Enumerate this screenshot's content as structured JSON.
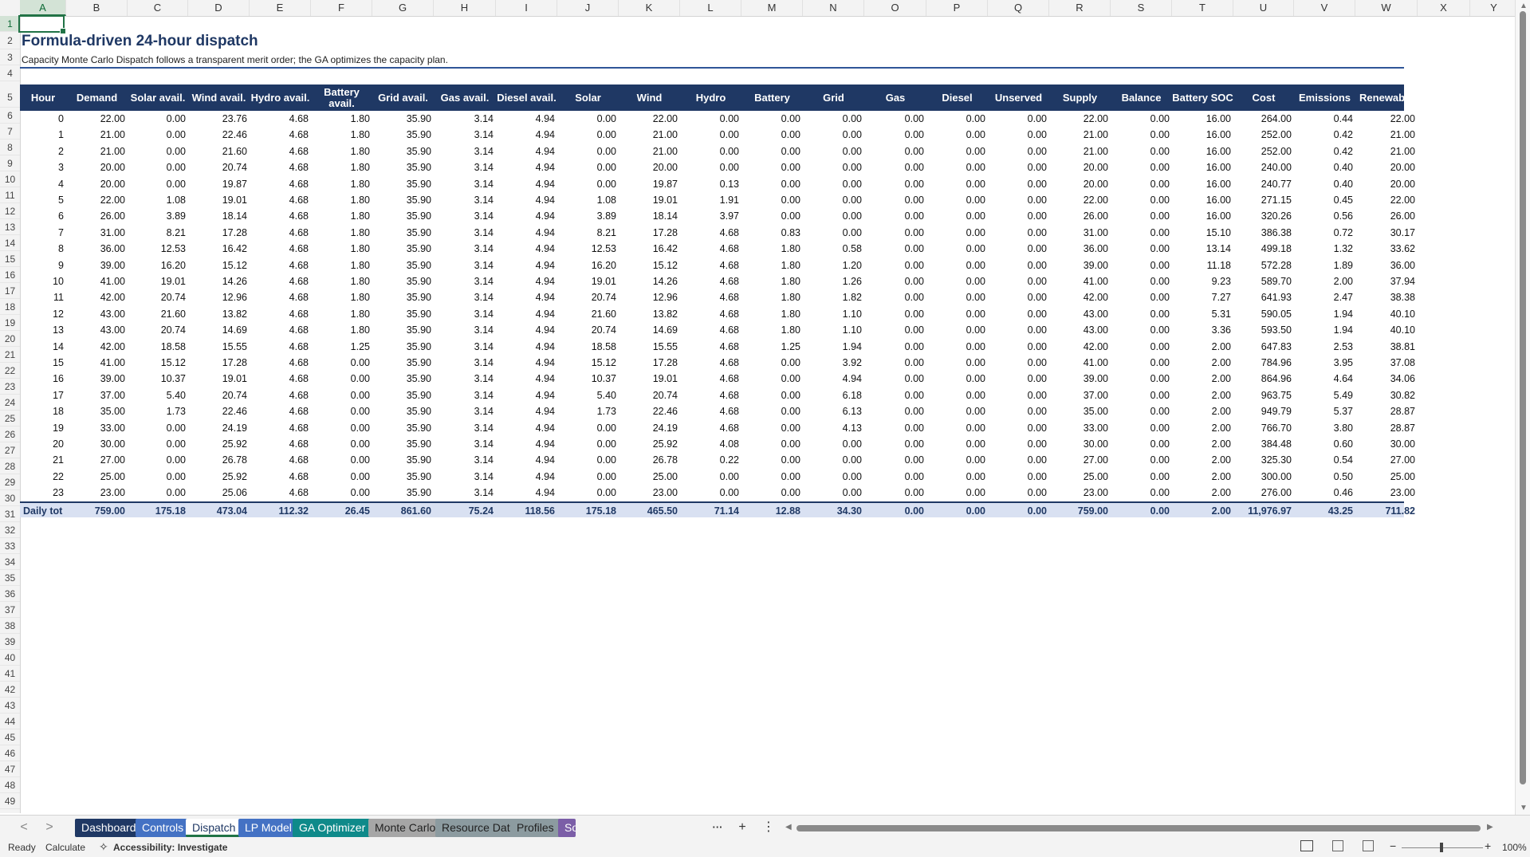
{
  "columns": [
    "A",
    "B",
    "C",
    "D",
    "E",
    "F",
    "G",
    "H",
    "I",
    "J",
    "K",
    "L",
    "M",
    "N",
    "O",
    "P",
    "Q",
    "R",
    "S",
    "T",
    "U",
    "V",
    "W",
    "X",
    "Y"
  ],
  "selected_column": "A",
  "rows": [
    "1",
    "2",
    "3",
    "4",
    "5",
    "6",
    "7",
    "8",
    "9",
    "10",
    "11",
    "12",
    "13",
    "14",
    "15",
    "16",
    "17",
    "18",
    "19",
    "20",
    "21",
    "22",
    "23",
    "24",
    "25",
    "26",
    "27",
    "28",
    "29",
    "30",
    "31",
    "32",
    "33",
    "34",
    "35",
    "36",
    "37",
    "38",
    "39",
    "40",
    "41",
    "42",
    "43",
    "44",
    "45",
    "46",
    "47",
    "48",
    "49"
  ],
  "selected_row": "1",
  "sheet": {
    "title": "Formula-driven 24-hour dispatch",
    "subtitle": "Capacity Monte Carlo  Dispatch follows a transparent merit order; the GA optimizes the capacity plan."
  },
  "table": {
    "headers": [
      "Hour",
      "Demand",
      "Solar avail.",
      "Wind avail.",
      "Hydro avail.",
      "Battery avail.",
      "Grid avail.",
      "Gas avail.",
      "Diesel avail.",
      "Solar",
      "Wind",
      "Hydro",
      "Battery",
      "Grid",
      "Gas",
      "Diesel",
      "Unserved",
      "Supply",
      "Balance",
      "Battery SOC",
      "Cost",
      "Emissions",
      "Renewable"
    ],
    "rows": [
      [
        "0",
        "22.00",
        "0.00",
        "23.76",
        "4.68",
        "1.80",
        "35.90",
        "3.14",
        "4.94",
        "0.00",
        "22.00",
        "0.00",
        "0.00",
        "0.00",
        "0.00",
        "0.00",
        "0.00",
        "22.00",
        "0.00",
        "16.00",
        "264.00",
        "0.44",
        "22.00"
      ],
      [
        "1",
        "21.00",
        "0.00",
        "22.46",
        "4.68",
        "1.80",
        "35.90",
        "3.14",
        "4.94",
        "0.00",
        "21.00",
        "0.00",
        "0.00",
        "0.00",
        "0.00",
        "0.00",
        "0.00",
        "21.00",
        "0.00",
        "16.00",
        "252.00",
        "0.42",
        "21.00"
      ],
      [
        "2",
        "21.00",
        "0.00",
        "21.60",
        "4.68",
        "1.80",
        "35.90",
        "3.14",
        "4.94",
        "0.00",
        "21.00",
        "0.00",
        "0.00",
        "0.00",
        "0.00",
        "0.00",
        "0.00",
        "21.00",
        "0.00",
        "16.00",
        "252.00",
        "0.42",
        "21.00"
      ],
      [
        "3",
        "20.00",
        "0.00",
        "20.74",
        "4.68",
        "1.80",
        "35.90",
        "3.14",
        "4.94",
        "0.00",
        "20.00",
        "0.00",
        "0.00",
        "0.00",
        "0.00",
        "0.00",
        "0.00",
        "20.00",
        "0.00",
        "16.00",
        "240.00",
        "0.40",
        "20.00"
      ],
      [
        "4",
        "20.00",
        "0.00",
        "19.87",
        "4.68",
        "1.80",
        "35.90",
        "3.14",
        "4.94",
        "0.00",
        "19.87",
        "0.13",
        "0.00",
        "0.00",
        "0.00",
        "0.00",
        "0.00",
        "20.00",
        "0.00",
        "16.00",
        "240.77",
        "0.40",
        "20.00"
      ],
      [
        "5",
        "22.00",
        "1.08",
        "19.01",
        "4.68",
        "1.80",
        "35.90",
        "3.14",
        "4.94",
        "1.08",
        "19.01",
        "1.91",
        "0.00",
        "0.00",
        "0.00",
        "0.00",
        "0.00",
        "22.00",
        "0.00",
        "16.00",
        "271.15",
        "0.45",
        "22.00"
      ],
      [
        "6",
        "26.00",
        "3.89",
        "18.14",
        "4.68",
        "1.80",
        "35.90",
        "3.14",
        "4.94",
        "3.89",
        "18.14",
        "3.97",
        "0.00",
        "0.00",
        "0.00",
        "0.00",
        "0.00",
        "26.00",
        "0.00",
        "16.00",
        "320.26",
        "0.56",
        "26.00"
      ],
      [
        "7",
        "31.00",
        "8.21",
        "17.28",
        "4.68",
        "1.80",
        "35.90",
        "3.14",
        "4.94",
        "8.21",
        "17.28",
        "4.68",
        "0.83",
        "0.00",
        "0.00",
        "0.00",
        "0.00",
        "31.00",
        "0.00",
        "15.10",
        "386.38",
        "0.72",
        "30.17"
      ],
      [
        "8",
        "36.00",
        "12.53",
        "16.42",
        "4.68",
        "1.80",
        "35.90",
        "3.14",
        "4.94",
        "12.53",
        "16.42",
        "4.68",
        "1.80",
        "0.58",
        "0.00",
        "0.00",
        "0.00",
        "36.00",
        "0.00",
        "13.14",
        "499.18",
        "1.32",
        "33.62"
      ],
      [
        "9",
        "39.00",
        "16.20",
        "15.12",
        "4.68",
        "1.80",
        "35.90",
        "3.14",
        "4.94",
        "16.20",
        "15.12",
        "4.68",
        "1.80",
        "1.20",
        "0.00",
        "0.00",
        "0.00",
        "39.00",
        "0.00",
        "11.18",
        "572.28",
        "1.89",
        "36.00"
      ],
      [
        "10",
        "41.00",
        "19.01",
        "14.26",
        "4.68",
        "1.80",
        "35.90",
        "3.14",
        "4.94",
        "19.01",
        "14.26",
        "4.68",
        "1.80",
        "1.26",
        "0.00",
        "0.00",
        "0.00",
        "41.00",
        "0.00",
        "9.23",
        "589.70",
        "2.00",
        "37.94"
      ],
      [
        "11",
        "42.00",
        "20.74",
        "12.96",
        "4.68",
        "1.80",
        "35.90",
        "3.14",
        "4.94",
        "20.74",
        "12.96",
        "4.68",
        "1.80",
        "1.82",
        "0.00",
        "0.00",
        "0.00",
        "42.00",
        "0.00",
        "7.27",
        "641.93",
        "2.47",
        "38.38"
      ],
      [
        "12",
        "43.00",
        "21.60",
        "13.82",
        "4.68",
        "1.80",
        "35.90",
        "3.14",
        "4.94",
        "21.60",
        "13.82",
        "4.68",
        "1.80",
        "1.10",
        "0.00",
        "0.00",
        "0.00",
        "43.00",
        "0.00",
        "5.31",
        "590.05",
        "1.94",
        "40.10"
      ],
      [
        "13",
        "43.00",
        "20.74",
        "14.69",
        "4.68",
        "1.80",
        "35.90",
        "3.14",
        "4.94",
        "20.74",
        "14.69",
        "4.68",
        "1.80",
        "1.10",
        "0.00",
        "0.00",
        "0.00",
        "43.00",
        "0.00",
        "3.36",
        "593.50",
        "1.94",
        "40.10"
      ],
      [
        "14",
        "42.00",
        "18.58",
        "15.55",
        "4.68",
        "1.25",
        "35.90",
        "3.14",
        "4.94",
        "18.58",
        "15.55",
        "4.68",
        "1.25",
        "1.94",
        "0.00",
        "0.00",
        "0.00",
        "42.00",
        "0.00",
        "2.00",
        "647.83",
        "2.53",
        "38.81"
      ],
      [
        "15",
        "41.00",
        "15.12",
        "17.28",
        "4.68",
        "0.00",
        "35.90",
        "3.14",
        "4.94",
        "15.12",
        "17.28",
        "4.68",
        "0.00",
        "3.92",
        "0.00",
        "0.00",
        "0.00",
        "41.00",
        "0.00",
        "2.00",
        "784.96",
        "3.95",
        "37.08"
      ],
      [
        "16",
        "39.00",
        "10.37",
        "19.01",
        "4.68",
        "0.00",
        "35.90",
        "3.14",
        "4.94",
        "10.37",
        "19.01",
        "4.68",
        "0.00",
        "4.94",
        "0.00",
        "0.00",
        "0.00",
        "39.00",
        "0.00",
        "2.00",
        "864.96",
        "4.64",
        "34.06"
      ],
      [
        "17",
        "37.00",
        "5.40",
        "20.74",
        "4.68",
        "0.00",
        "35.90",
        "3.14",
        "4.94",
        "5.40",
        "20.74",
        "4.68",
        "0.00",
        "6.18",
        "0.00",
        "0.00",
        "0.00",
        "37.00",
        "0.00",
        "2.00",
        "963.75",
        "5.49",
        "30.82"
      ],
      [
        "18",
        "35.00",
        "1.73",
        "22.46",
        "4.68",
        "0.00",
        "35.90",
        "3.14",
        "4.94",
        "1.73",
        "22.46",
        "4.68",
        "0.00",
        "6.13",
        "0.00",
        "0.00",
        "0.00",
        "35.00",
        "0.00",
        "2.00",
        "949.79",
        "5.37",
        "28.87"
      ],
      [
        "19",
        "33.00",
        "0.00",
        "24.19",
        "4.68",
        "0.00",
        "35.90",
        "3.14",
        "4.94",
        "0.00",
        "24.19",
        "4.68",
        "0.00",
        "4.13",
        "0.00",
        "0.00",
        "0.00",
        "33.00",
        "0.00",
        "2.00",
        "766.70",
        "3.80",
        "28.87"
      ],
      [
        "20",
        "30.00",
        "0.00",
        "25.92",
        "4.68",
        "0.00",
        "35.90",
        "3.14",
        "4.94",
        "0.00",
        "25.92",
        "4.08",
        "0.00",
        "0.00",
        "0.00",
        "0.00",
        "0.00",
        "30.00",
        "0.00",
        "2.00",
        "384.48",
        "0.60",
        "30.00"
      ],
      [
        "21",
        "27.00",
        "0.00",
        "26.78",
        "4.68",
        "0.00",
        "35.90",
        "3.14",
        "4.94",
        "0.00",
        "26.78",
        "0.22",
        "0.00",
        "0.00",
        "0.00",
        "0.00",
        "0.00",
        "27.00",
        "0.00",
        "2.00",
        "325.30",
        "0.54",
        "27.00"
      ],
      [
        "22",
        "25.00",
        "0.00",
        "25.92",
        "4.68",
        "0.00",
        "35.90",
        "3.14",
        "4.94",
        "0.00",
        "25.00",
        "0.00",
        "0.00",
        "0.00",
        "0.00",
        "0.00",
        "0.00",
        "25.00",
        "0.00",
        "2.00",
        "300.00",
        "0.50",
        "25.00"
      ],
      [
        "23",
        "23.00",
        "0.00",
        "25.06",
        "4.68",
        "0.00",
        "35.90",
        "3.14",
        "4.94",
        "0.00",
        "23.00",
        "0.00",
        "0.00",
        "0.00",
        "0.00",
        "0.00",
        "0.00",
        "23.00",
        "0.00",
        "2.00",
        "276.00",
        "0.46",
        "23.00"
      ]
    ],
    "total": [
      "Daily tot",
      "759.00",
      "175.18",
      "473.04",
      "112.32",
      "26.45",
      "861.60",
      "75.24",
      "118.56",
      "175.18",
      "465.50",
      "71.14",
      "12.88",
      "34.30",
      "0.00",
      "0.00",
      "0.00",
      "759.00",
      "0.00",
      "2.00",
      "11,976.97",
      "43.25",
      "711.82"
    ]
  },
  "tabs": [
    {
      "label": "Dashboard",
      "bg": "#1f3864",
      "fg": "#ffffff"
    },
    {
      "label": "Controls",
      "bg": "#4472c4",
      "fg": "#ffffff"
    },
    {
      "label": "Dispatch",
      "bg": "#ffffff",
      "fg": "#1f3864",
      "active": true
    },
    {
      "label": "LP Model",
      "bg": "#4472c4",
      "fg": "#ffffff"
    },
    {
      "label": "GA Optimizer",
      "bg": "#0f8a8a",
      "fg": "#ffffff"
    },
    {
      "label": "Monte Carlo",
      "bg": "#a6a6a6",
      "fg": "#222222"
    },
    {
      "label": "Resource Data",
      "bg": "#8c9ba0",
      "fg": "#222222"
    },
    {
      "label": "Profiles",
      "bg": "#8c9ba0",
      "fg": "#222222"
    },
    {
      "label": "Sol",
      "bg": "#7b5ea7",
      "fg": "#ffffff"
    }
  ],
  "tabbar": {
    "more": "···",
    "add": "+",
    "options": "⋮",
    "prev": "<",
    "next": ">"
  },
  "status": {
    "ready": "Ready",
    "calculate": "Calculate",
    "accessibility": "Accessibility: Investigate",
    "zoom": "100%"
  },
  "colors": {
    "header_bg": "#1f3864",
    "total_bg": "#d9e1f2",
    "accent": "#217346"
  }
}
